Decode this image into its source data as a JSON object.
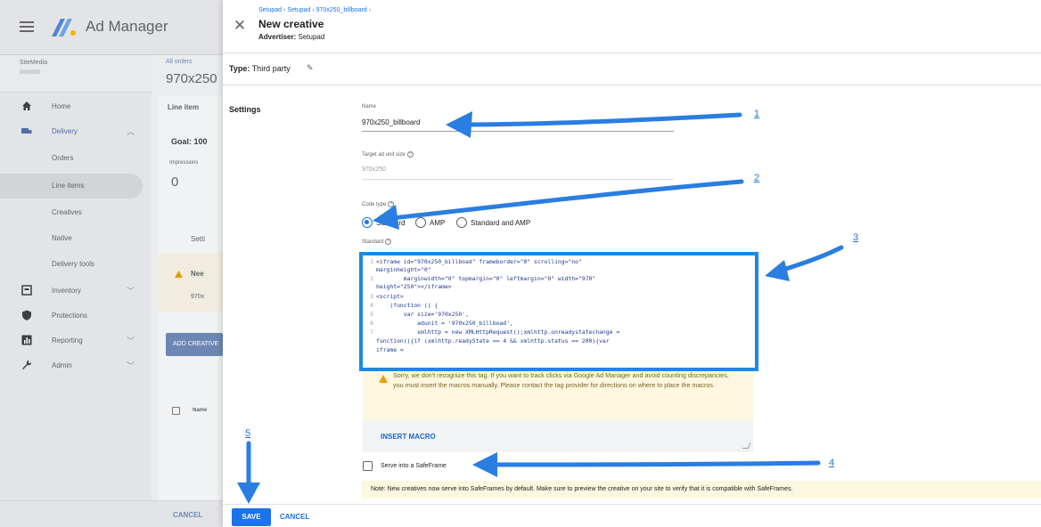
{
  "background_app": {
    "app_title": "Ad Manager",
    "network_name": "SiteMedia",
    "network_sub": "0000000",
    "nav": [
      {
        "label": "Home",
        "icon": "home-icon"
      },
      {
        "label": "Delivery",
        "icon": "delivery-icon",
        "active_parent": true
      },
      {
        "label": "Orders",
        "icon": ""
      },
      {
        "label": "Line items",
        "icon": "",
        "active": true
      },
      {
        "label": "Creatives",
        "icon": ""
      },
      {
        "label": "Native",
        "icon": ""
      },
      {
        "label": "Delivery tools",
        "icon": ""
      },
      {
        "label": "Inventory",
        "icon": "inventory-icon"
      },
      {
        "label": "Protections",
        "icon": "shield-icon"
      },
      {
        "label": "Reporting",
        "icon": "reporting-icon"
      },
      {
        "label": "Admin",
        "icon": "wrench-icon"
      }
    ],
    "breadcrumb": "All orders",
    "order_title": "970x250",
    "card_tab": "Line item",
    "goal": "Goal: 100",
    "impressions_label": "Impressions",
    "impressions_value": "0",
    "settings_tab": "Setti",
    "warn_title": "Nee",
    "warn_sub": "970x",
    "add_button": "ADD CREATIVE",
    "row_label": "Name",
    "cancel": "CANCEL"
  },
  "dialog": {
    "breadcrumb": "Setupad › Setupad › 970x250_billboard ›",
    "title": "New creative",
    "advertiser_label": "Advertiser:",
    "advertiser_value": "Setupad",
    "type_label": "Type:",
    "type_value": "Third party",
    "settings_label": "Settings",
    "name_label": "Name",
    "name_value": "970x250_billboard",
    "target_size_label": "Target ad unit size",
    "target_size_value": "970x250",
    "code_type_label": "Code type",
    "code_type_options": [
      "Standard",
      "AMP",
      "Standard and AMP"
    ],
    "code_type_selected": "Standard",
    "standard_label": "Standard",
    "code_lines": [
      {
        "num": "1",
        "text": "<iframe id=\"970x250_billboad\" frameborder=\"0\" scrolling=\"no\""
      },
      {
        "num": "",
        "text": "marginheight=\"0\""
      },
      {
        "num": "2",
        "text": "        marginwidth=\"0\" topmargin=\"0\" leftmargin=\"0\" width=\"970\""
      },
      {
        "num": "",
        "text": "height=\"250\"></iframe>"
      },
      {
        "num": "3",
        "text": "<script>"
      },
      {
        "num": "4",
        "text": "    (function () {"
      },
      {
        "num": "5",
        "text": "        var size='970x250',"
      },
      {
        "num": "6",
        "text": "            adunit = '970x250_billboad',"
      },
      {
        "num": "7",
        "text": "            xmlhttp = new XMLHttpRequest();xmlhttp.onreadystatechange ="
      },
      {
        "num": "",
        "text": "function(){if (xmlhttp.readyState == 4 && xmlhttp.status == 200){var"
      },
      {
        "num": "",
        "text": "iframe ="
      }
    ],
    "warning_text": "Sorry, we don't recognize this tag. If you want to track clicks via Google Ad Manager and avoid counting discrepancies, you must insert the macros manually. Please contact the tag provider for directions on where to place the macros.",
    "insert_macro": "INSERT MACRO",
    "safeframe_label": "Serve into a SafeFrame",
    "safeframe_checked": false,
    "note": "Note: New creatives now serve into SafeFrames by default. Make sure to preview the creative on your site to verify that it is compatible with SafeFrames.",
    "save": "SAVE",
    "cancel": "CANCEL"
  },
  "annotations": [
    {
      "label": "1"
    },
    {
      "label": "2"
    },
    {
      "label": "3"
    },
    {
      "label": "4"
    },
    {
      "label": "5"
    }
  ],
  "colors": {
    "accent": "#1a73e8",
    "annotation": "#1e88e5",
    "warning_bg": "#fef7e0"
  }
}
